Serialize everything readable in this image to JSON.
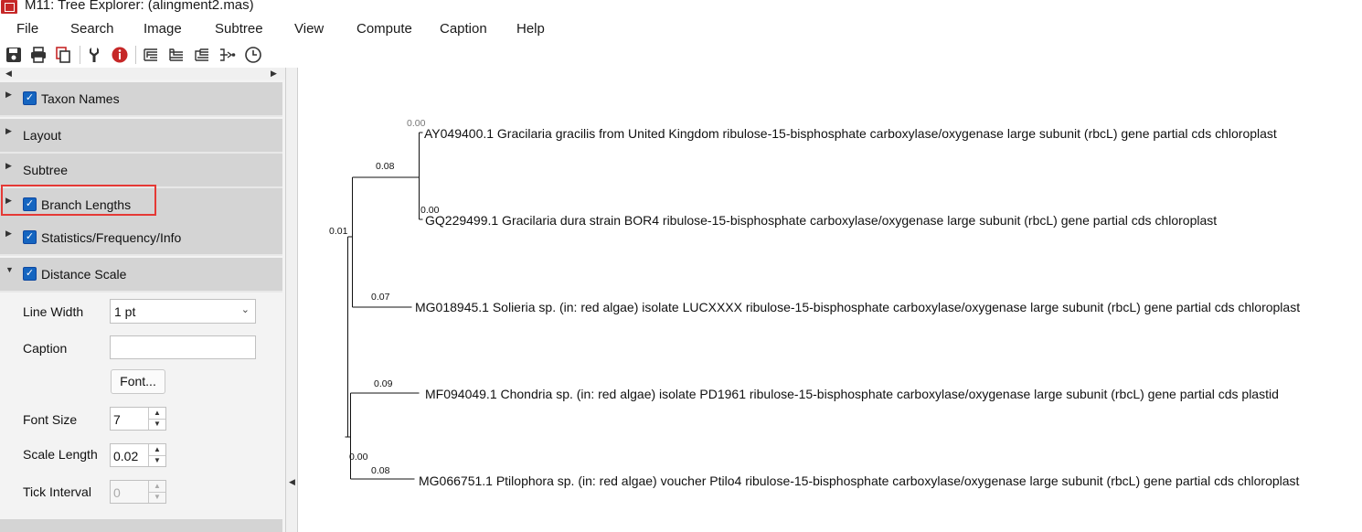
{
  "window": {
    "title": "M11: Tree Explorer: (alingment2.mas)"
  },
  "menu": [
    "File",
    "Search",
    "Image",
    "Subtree",
    "View",
    "Compute",
    "Caption",
    "Help"
  ],
  "toolbar": {
    "icons": [
      "save-icon",
      "print-icon",
      "copy-icon",
      "wrench-icon",
      "info-icon",
      "tree-style-icon",
      "tree-style-alt-icon",
      "tree-compact-icon",
      "radiation-tree-icon",
      "clock-icon"
    ],
    "info_color": "#c62828"
  },
  "panel": {
    "sections": [
      {
        "label": "Taxon Names",
        "checked": true,
        "expanded": false
      },
      {
        "label": "Layout",
        "checked": null,
        "expanded": false
      },
      {
        "label": "Subtree",
        "checked": null,
        "expanded": false
      },
      {
        "label": "Branch Lengths",
        "checked": true,
        "expanded": false,
        "highlighted": true
      },
      {
        "label": "Statistics/Frequency/Info",
        "checked": true,
        "expanded": false
      },
      {
        "label": "Distance Scale",
        "checked": true,
        "expanded": true
      }
    ],
    "distance_scale": {
      "line_width_label": "Line Width",
      "line_width_value": "1 pt",
      "caption_label": "Caption",
      "caption_value": "",
      "font_button": "Font...",
      "font_size_label": "Font Size",
      "font_size_value": "7",
      "scale_length_label": "Scale Length",
      "scale_length_value": "0.02",
      "tick_interval_label": "Tick Interval",
      "tick_interval_value": "0"
    },
    "highlight_color": "#e53935"
  },
  "tree": {
    "taxa": [
      "AY049400.1 Gracilaria gracilis from United Kingdom ribulose-15-bisphosphate carboxylase/oxygenase large subunit (rbcL) gene partial cds chloroplast",
      "GQ229499.1 Gracilaria dura strain BOR4 ribulose-15-bisphosphate carboxylase/oxygenase large subunit (rbcL) gene partial cds chloroplast",
      "MG018945.1 Solieria sp. (in: red algae) isolate LUCXXXX ribulose-15-bisphosphate carboxylase/oxygenase large subunit (rbcL) gene partial cds chloroplast",
      "MF094049.1 Chondria sp. (in: red algae) isolate PD1961 ribulose-15-bisphosphate carboxylase/oxygenase large subunit (rbcL) gene partial cds plastid",
      "MG066751.1 Ptilophora sp. (in: red algae) voucher Ptilo4 ribulose-15-bisphosphate carboxylase/oxygenase large subunit (rbcL) gene partial cds chloroplast"
    ],
    "branch_lengths": {
      "ay049400": "0.00",
      "gq229499": "0.00",
      "gracilaria_clade": "0.08",
      "ingroup": "0.01",
      "mg018945": "0.07",
      "mf094049": "0.09",
      "lower_clade": "0.00",
      "mg066751": "0.08"
    }
  }
}
